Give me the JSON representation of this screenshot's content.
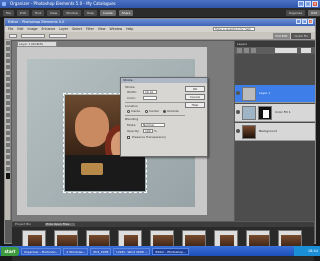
{
  "outer_window": {
    "title": "Organizer - Photoshop Elements 5.0 - My Catalogues"
  },
  "outer_toolbar": {
    "buttons": [
      "File",
      "Edit",
      "Find",
      "View",
      "Window",
      "Help",
      "Create",
      "Share"
    ],
    "right": [
      "Organize",
      "Edit"
    ]
  },
  "editor": {
    "title": "Editor - Photoshop Elements 5.0",
    "menus": [
      "File",
      "Edit",
      "Image",
      "Enhance",
      "Layer",
      "Select",
      "Filter",
      "View",
      "Window",
      "Help"
    ],
    "help_placeholder": "Type a question for help",
    "modes": [
      "Full Edit",
      "Quick Fix"
    ],
    "doc_tab": "Layer 1 (RGB/8)"
  },
  "stroke_dialog": {
    "title": "Stroke",
    "stroke_group": "Stroke",
    "width_label": "Width:",
    "width_value": "10 px",
    "color_label": "Color:",
    "location_group": "Location",
    "location_options": [
      "Inside",
      "Center",
      "Outside"
    ],
    "location_selected": "Outside",
    "blending_group": "Blending",
    "mode_label": "Mode:",
    "mode_value": "Normal",
    "opacity_label": "Opacity:",
    "opacity_value": "100",
    "opacity_unit": "%",
    "preserve_label": "Preserve Transparency",
    "buttons": [
      "OK",
      "Cancel",
      "Help"
    ]
  },
  "layers_panel": {
    "header": "Layers",
    "layers": [
      {
        "name": "Layer 1",
        "selected": true
      },
      {
        "name": "Color Fill 1",
        "selected": false
      },
      {
        "name": "Background",
        "selected": false
      }
    ]
  },
  "project_bin": {
    "tabs": [
      "Project Bin"
    ],
    "hide_label": "Hide Open Files"
  },
  "taskbar": {
    "start": "start",
    "tasks": [
      "Organizer - Photosho...",
      "2 Windows...",
      "PC3_0038",
      "Untitl - Wind 2008 ...",
      "Editor - Photoshop..."
    ],
    "clock": "18:44",
    "colors": {
      "taskbar": "#1d4fb8",
      "start": "#3d9b3d"
    }
  }
}
